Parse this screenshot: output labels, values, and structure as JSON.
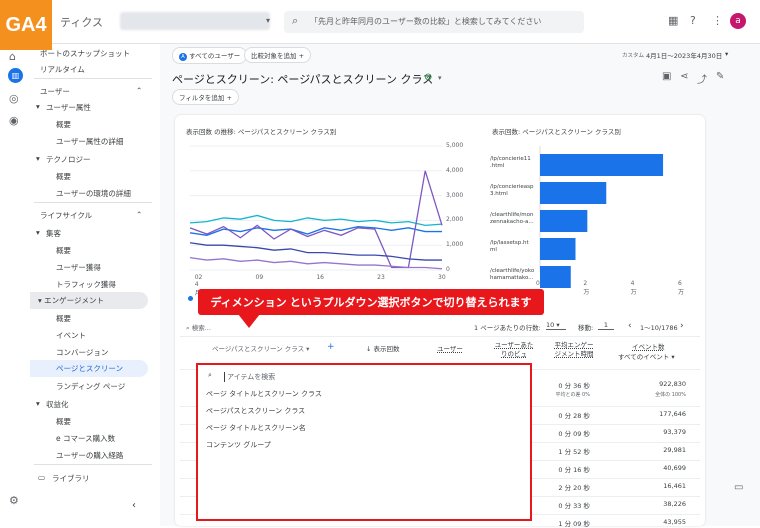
{
  "app": {
    "badge": "GA4",
    "title": "ティクス",
    "search_placeholder": "「先月と昨年同月のユーザー数の比較」と検索してみてください",
    "avatar": "a"
  },
  "sidebar": {
    "items": [
      "ポートのスナップショット",
      "リアルタイム",
      "ユーザー",
      "ユーザー属性",
      "概要",
      "ユーザー属性の詳細",
      "テクノロジー",
      "概要",
      "ユーザーの環境の詳細",
      "ライフサイクル",
      "集客",
      "概要",
      "ユーザー獲得",
      "トラフィック獲得",
      "エンゲージメント",
      "概要",
      "イベント",
      "コンバージョン",
      "ページとスクリーン",
      "ランディング ページ",
      "収益化",
      "概要",
      "e コマース購入数",
      "ユーザーの購入経路",
      "ライブラリ"
    ]
  },
  "header": {
    "all_users": "すべてのユーザー",
    "add_compare": "比較対象を追加",
    "date_prefix": "カスタム",
    "date_range": "4月1日〜2023年4月30日",
    "title": "ページとスクリーン: ページパスとスクリーン クラス",
    "add_filter": "フィルタを追加"
  },
  "chart_line": {
    "title": "表示回数 の推移: ページパスとスクリーン クラス別",
    "yticks": [
      "5,000",
      "4,000",
      "3,000",
      "2,000",
      "1,000",
      "0"
    ],
    "xticks": [
      "02",
      "09",
      "16",
      "23",
      "30"
    ],
    "xsub": "4月"
  },
  "chart_bar": {
    "title": "表示回数: ページパスとスクリーン クラス別",
    "labels": [
      "/lp/concierie11\n.html",
      "/lp/concierieasp\n3.html",
      "/clearthlife/mon\nzennakacho-a...",
      "/lp/lassetsp.ht\nml",
      "/clearthlife/yoko\nhamamattako..."
    ],
    "xticks": [
      "0",
      "2万",
      "4万",
      "6万"
    ]
  },
  "callout": "ディメンション というプルダウン選択ボタンで切り替えられます",
  "table": {
    "search_placeholder": "検索...",
    "rows_per_page_label": "1 ページあたりの行数:",
    "rows_per_page": "10",
    "goto_label": "移動:",
    "goto": "1",
    "pagination": "1〜10/1786",
    "dim_header": "ページパスとスクリーン クラス",
    "col_views": "表示回数",
    "col_users": "ユーザー",
    "col_views_per_user": "ユーザーあたりのビュ",
    "col_avg_eng": "平均エンゲージメント時間",
    "col_events": "イベント数",
    "col_events_sub": "すべてのイベント",
    "total_avg": "0 分 36 秒",
    "total_avg_sub": "平均との差 0%",
    "total_events": "922,830",
    "total_events_sub": "全体の 100%",
    "avg_times": [
      "0 分 28 秒",
      "0 分 09 秒",
      "1 分 52 秒",
      "0 分 16 秒",
      "2 分 20 秒",
      "0 分 33 秒",
      "1 分 09 秒"
    ],
    "events": [
      "177,646",
      "93,379",
      "29,981",
      "40,699",
      "16,461",
      "38,226",
      "43,955"
    ]
  },
  "dropdown": {
    "search_placeholder": "アイテムを検索",
    "options": [
      "ページ タイトルとスクリーン クラス",
      "ページパスとスクリーン クラス",
      "ページ タイトルとスクリーン名",
      "コンテンツ グループ"
    ]
  },
  "chart_data": [
    {
      "type": "line",
      "title": "表示回数 の推移: ページパスとスクリーン クラス別",
      "x": [
        "04-01",
        "04-03",
        "04-05",
        "04-07",
        "04-09",
        "04-11",
        "04-13",
        "04-15",
        "04-17",
        "04-19",
        "04-21",
        "04-23",
        "04-25",
        "04-27",
        "04-29",
        "04-30"
      ],
      "series": [
        {
          "color": "#1a73e8",
          "values": [
            1500,
            1400,
            1650,
            1550,
            1700,
            1600,
            1650,
            1450,
            1700,
            1600,
            1750,
            1700,
            1600,
            1700,
            1550,
            1550
          ]
        },
        {
          "color": "#12b5cb",
          "values": [
            1900,
            1950,
            2100,
            2050,
            2200,
            2000,
            1950,
            2100,
            2000,
            2050,
            1950,
            2000,
            1900,
            1950,
            1800,
            1850
          ]
        },
        {
          "color": "#7e57c2",
          "values": [
            1700,
            1450,
            1750,
            1300,
            1800,
            1250,
            1650,
            1350,
            1600,
            1400,
            1700,
            1650,
            100,
            100,
            4000,
            1800
          ]
        },
        {
          "color": "#3949ab",
          "values": [
            1100,
            1000,
            1000,
            950,
            900,
            800,
            850,
            700,
            700,
            650,
            600,
            600,
            550,
            450,
            400,
            400
          ]
        },
        {
          "color": "#9575cd",
          "values": [
            500,
            400,
            450,
            350,
            400,
            300,
            350,
            250,
            300,
            250,
            200,
            200,
            150,
            100,
            100,
            50
          ]
        }
      ],
      "ylim": [
        0,
        5000
      ]
    },
    {
      "type": "bar",
      "title": "表示回数: ページパスとスクリーン クラス別",
      "categories": [
        "/lp/concierie11.html",
        "/lp/concierieasp3.html",
        "/clearthlife/monzennakacho-a...",
        "/lp/lassetsp.html",
        "/clearthlife/yokohamamattako..."
      ],
      "values": [
        52000,
        28000,
        20000,
        15000,
        13000
      ],
      "xlim": [
        0,
        60000
      ]
    }
  ]
}
